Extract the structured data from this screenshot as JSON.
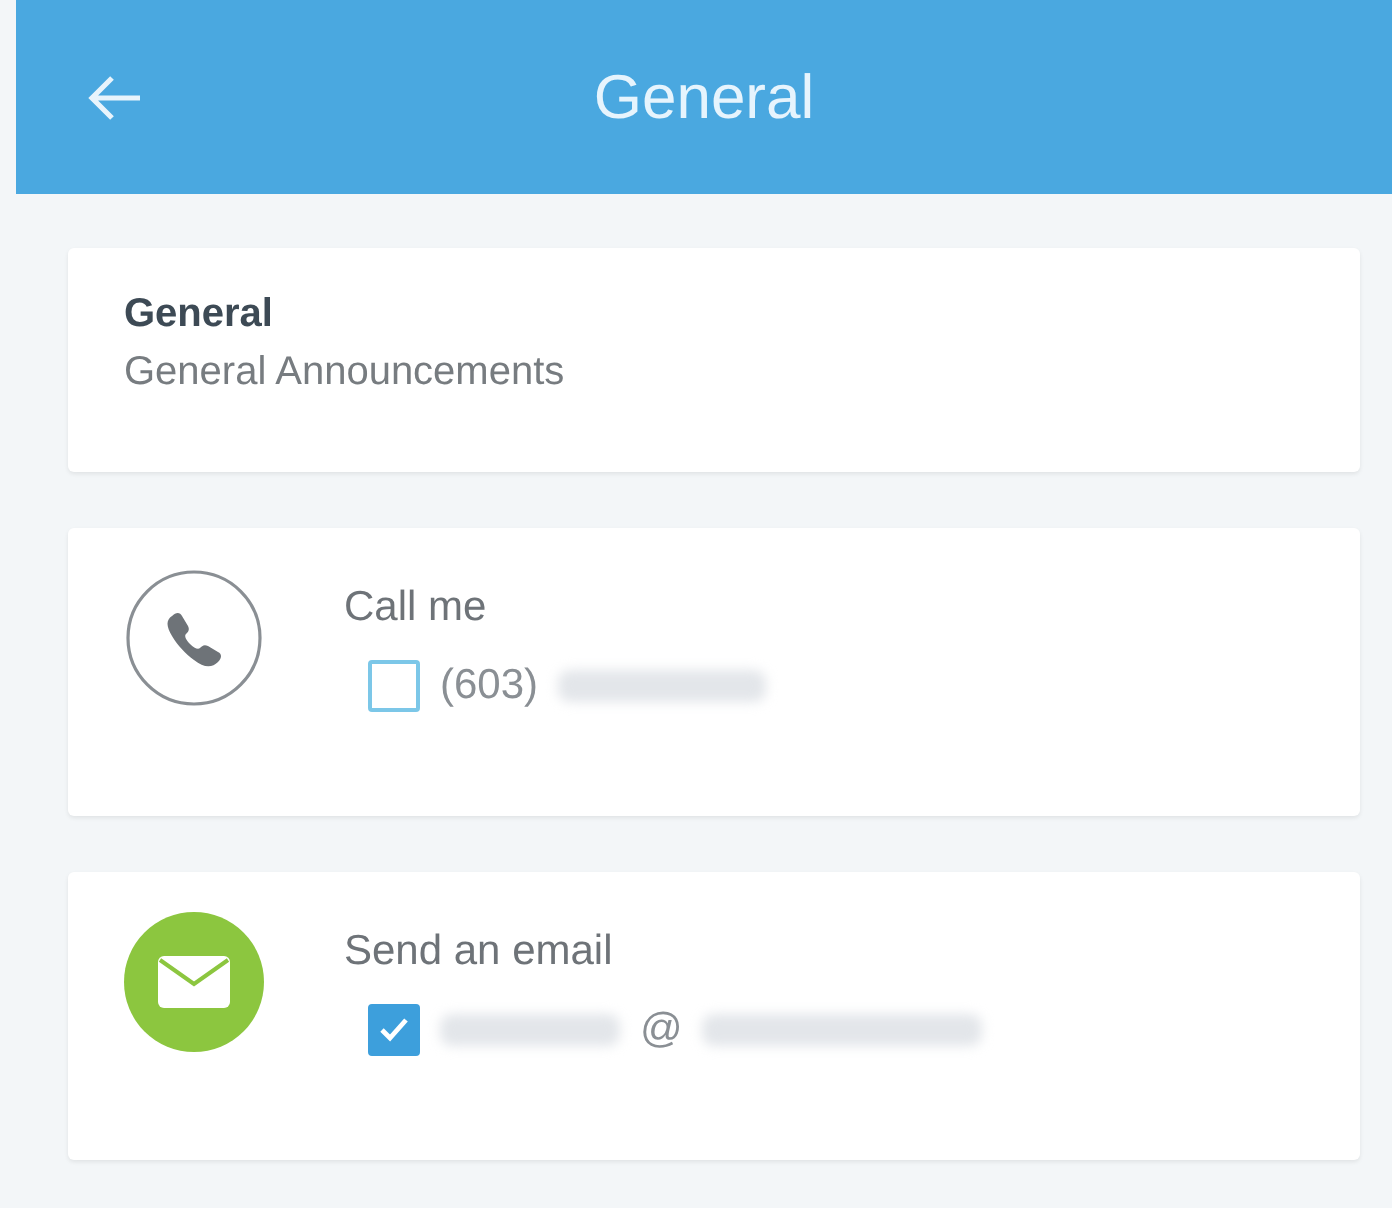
{
  "header": {
    "title": "General"
  },
  "group": {
    "name": "General",
    "description": "General Announcements"
  },
  "options": [
    {
      "kind": "phone",
      "label": "Call me",
      "checked": false,
      "value_before": "(603)"
    },
    {
      "kind": "email",
      "label": "Send an email",
      "checked": true,
      "value_after": "@"
    }
  ]
}
